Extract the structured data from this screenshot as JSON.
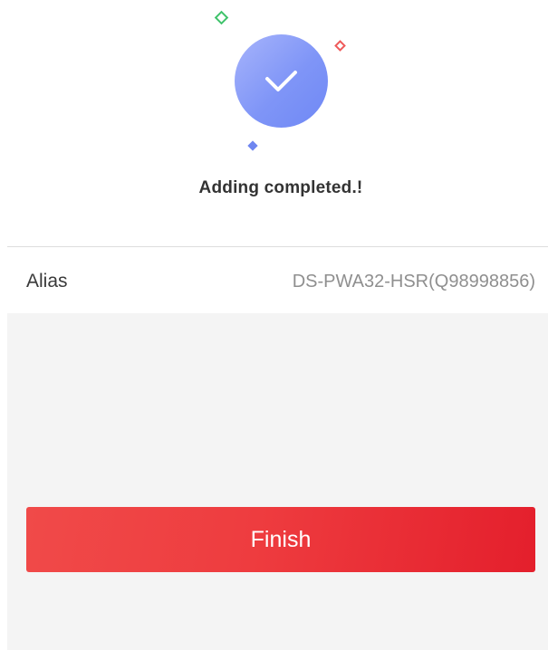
{
  "result": {
    "status_icon": "checkmark-icon",
    "status_text": "Adding completed.!",
    "colors": {
      "circle": "#7f95f7",
      "diamond_green": "#3fc36b",
      "diamond_red": "#ef5a5a",
      "diamond_blue": "#6f86f0"
    }
  },
  "device": {
    "alias_label": "Alias",
    "alias_value": "DS-PWA32-HSR(Q98998856)"
  },
  "actions": {
    "finish_label": "Finish",
    "finish_color": "#e8303a"
  }
}
